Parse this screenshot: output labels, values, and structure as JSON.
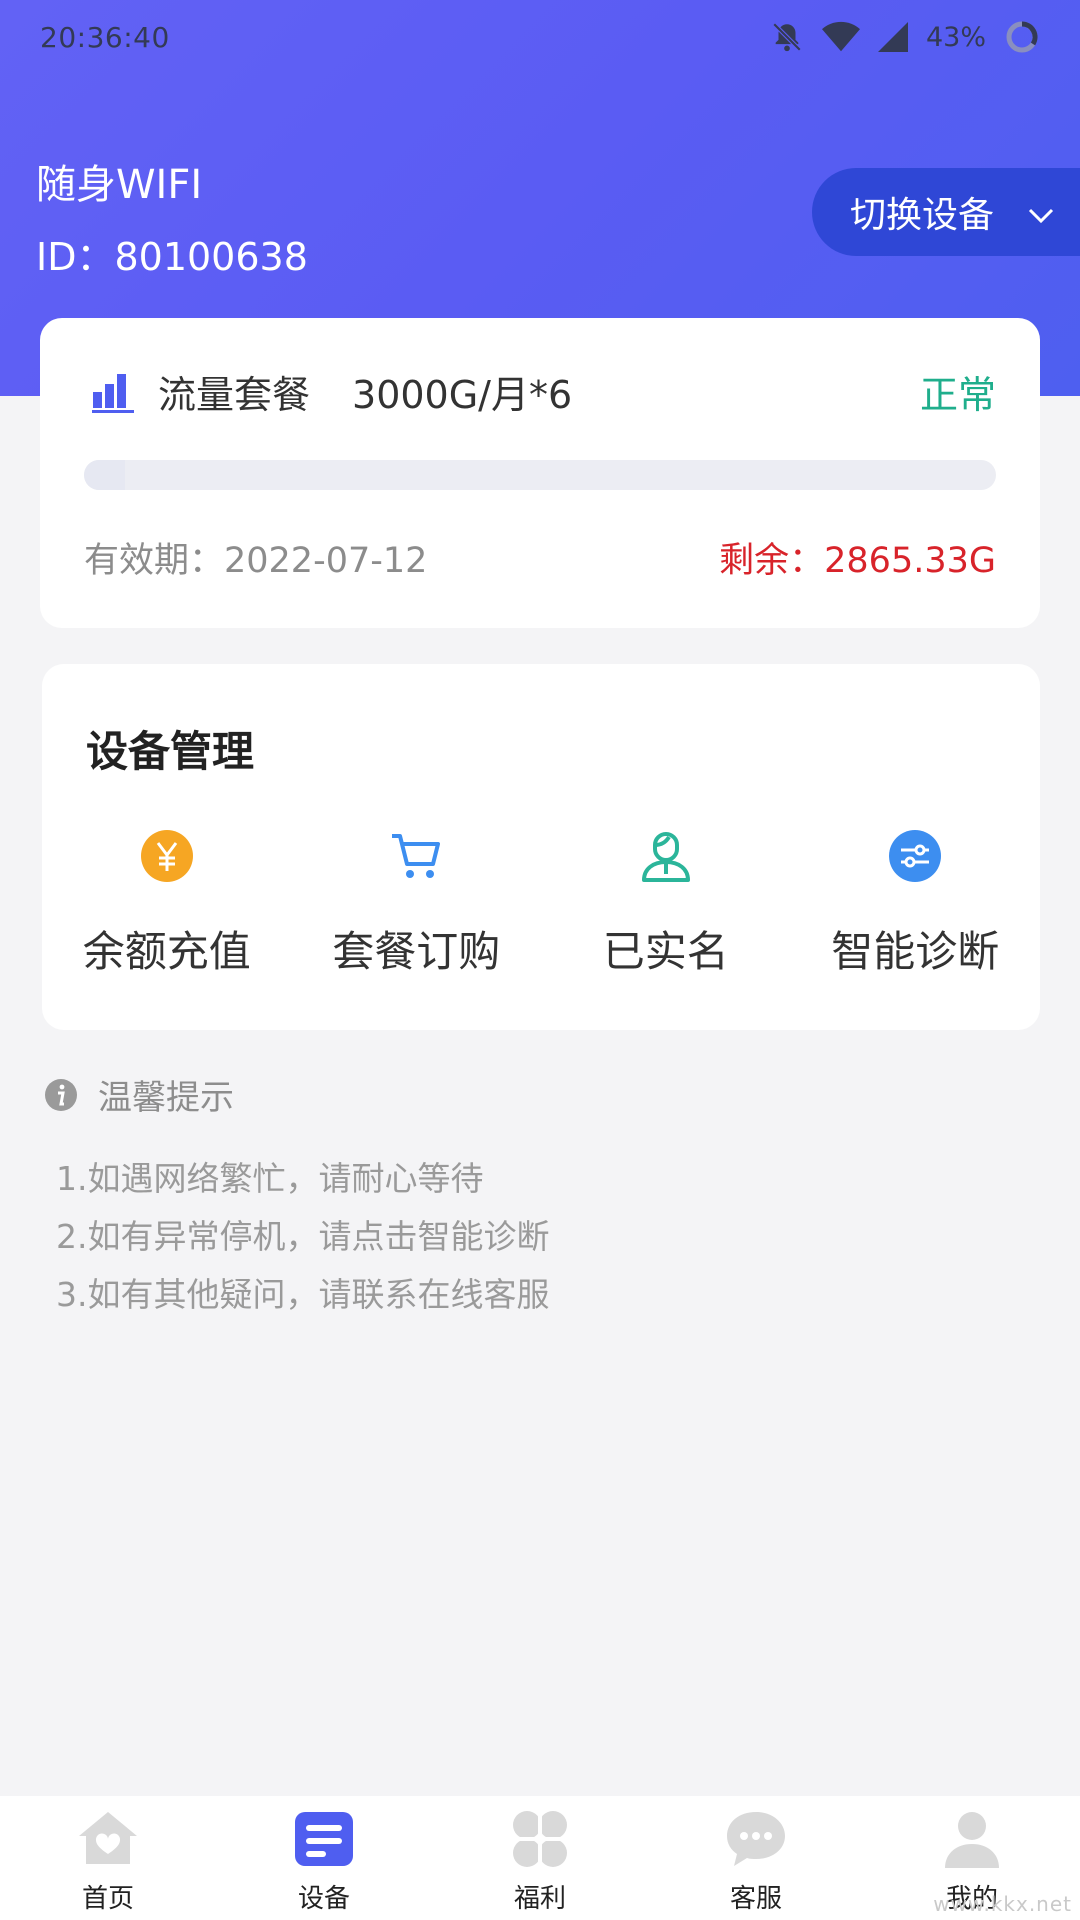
{
  "status_bar": {
    "time": "20:36:40",
    "battery": "43%",
    "icons": [
      "bell-muted-icon",
      "wifi-icon",
      "signal-icon",
      "battery-ring-icon"
    ]
  },
  "header": {
    "device_name": "随身WIFI",
    "device_id": "ID：80100638",
    "switch_label": "切换设备"
  },
  "plan": {
    "title": "流量套餐",
    "size": "3000G/月*6",
    "status": "正常",
    "expiry": "有效期：2022-07-12",
    "remaining": "剩余：2865.33G",
    "used_fraction": 0.045
  },
  "management": {
    "title": "设备管理",
    "items": [
      {
        "label": "余额充值",
        "icon": "yen-coin-icon"
      },
      {
        "label": "套餐订购",
        "icon": "cart-icon"
      },
      {
        "label": "已实名",
        "icon": "user-verified-icon"
      },
      {
        "label": "智能诊断",
        "icon": "diagnose-sliders-icon"
      }
    ]
  },
  "tips": {
    "title": "温馨提示",
    "lines": [
      "1.如遇网络繁忙，请耐心等待",
      "2.如有异常停机，请点击智能诊断",
      "3.如有其他疑问，请联系在线客服"
    ]
  },
  "tab_bar": {
    "items": [
      {
        "label": "首页",
        "icon": "home-icon",
        "active": false
      },
      {
        "label": "设备",
        "icon": "device-icon",
        "active": true
      },
      {
        "label": "福利",
        "icon": "clover-icon",
        "active": false
      },
      {
        "label": "客服",
        "icon": "chat-icon",
        "active": false
      },
      {
        "label": "我的",
        "icon": "profile-icon",
        "active": false
      }
    ]
  },
  "watermark": "www.kkx.net",
  "colors": {
    "header": "#5a5cf3",
    "accent": "#4f5ef0",
    "status_ok": "#1fae8c",
    "remaining": "#d8232a",
    "yen": "#f6a623",
    "cart": "#3d8ef0",
    "user": "#2bb59a",
    "diagnose": "#3d8ef0"
  }
}
